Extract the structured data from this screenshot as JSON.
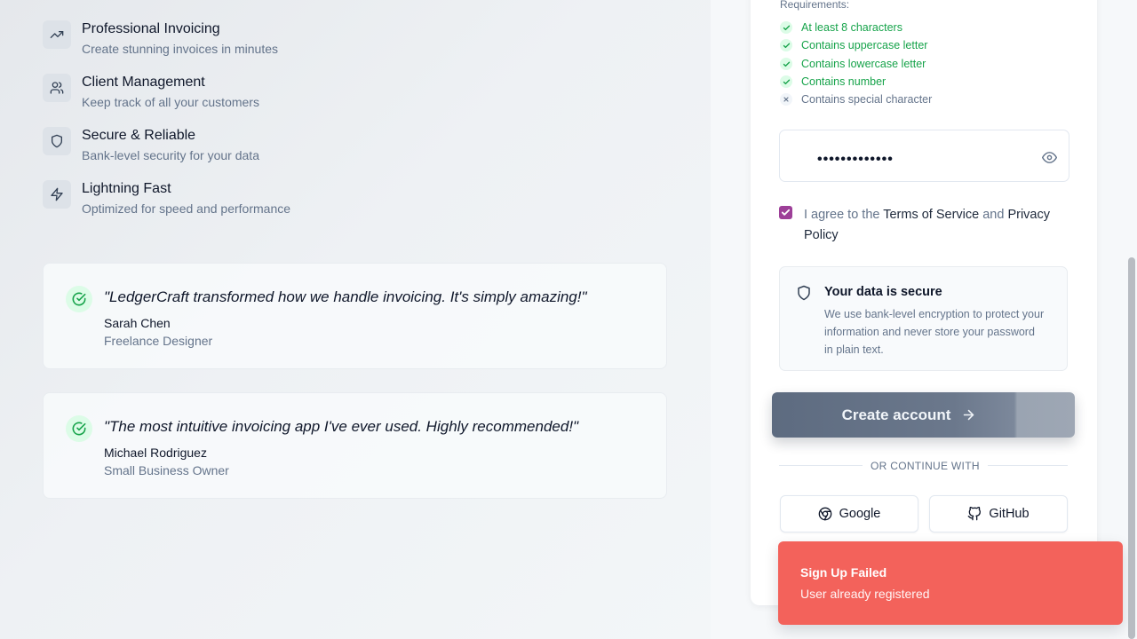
{
  "features": [
    {
      "title": "Professional Invoicing",
      "desc": "Create stunning invoices in minutes",
      "icon": "trending-up-icon"
    },
    {
      "title": "Client Management",
      "desc": "Keep track of all your customers",
      "icon": "users-icon"
    },
    {
      "title": "Secure & Reliable",
      "desc": "Bank-level security for your data",
      "icon": "shield-icon"
    },
    {
      "title": "Lightning Fast",
      "desc": "Optimized for speed and performance",
      "icon": "zap-icon"
    }
  ],
  "testimonials": [
    {
      "quote": "\"LedgerCraft transformed how we handle invoicing. It's simply amazing!\"",
      "author": "Sarah Chen",
      "role": "Freelance Designer"
    },
    {
      "quote": "\"The most intuitive invoicing app I've ever used. Highly recommended!\"",
      "author": "Michael Rodriguez",
      "role": "Small Business Owner"
    }
  ],
  "requirements": {
    "label": "Requirements:",
    "items": [
      {
        "text": "At least 8 characters",
        "met": true
      },
      {
        "text": "Contains uppercase letter",
        "met": true
      },
      {
        "text": "Contains lowercase letter",
        "met": true
      },
      {
        "text": "Contains number",
        "met": true
      },
      {
        "text": "Contains special character",
        "met": false
      }
    ]
  },
  "password_field": {
    "value": "•••••••••••••",
    "icon": "eye-icon"
  },
  "agreement": {
    "checked": true,
    "prefix": "I agree to the ",
    "terms": "Terms of Service",
    "middle": " and ",
    "privacy": "Privacy Policy"
  },
  "security_notice": {
    "title": "Your data is secure",
    "desc": "We use bank-level encryption to protect your information and never store your password in plain text.",
    "icon": "shield-icon"
  },
  "create_button": {
    "label": "Create account",
    "icon": "arrow-right-icon"
  },
  "divider": {
    "label": "OR CONTINUE WITH"
  },
  "social": {
    "google": "Google",
    "github": "GitHub"
  },
  "toast": {
    "title": "Sign Up Failed",
    "message": "User already registered"
  },
  "colors": {
    "success": "#16a34a",
    "error_toast": "#f3625b",
    "checkbox": "#9d3f98"
  }
}
